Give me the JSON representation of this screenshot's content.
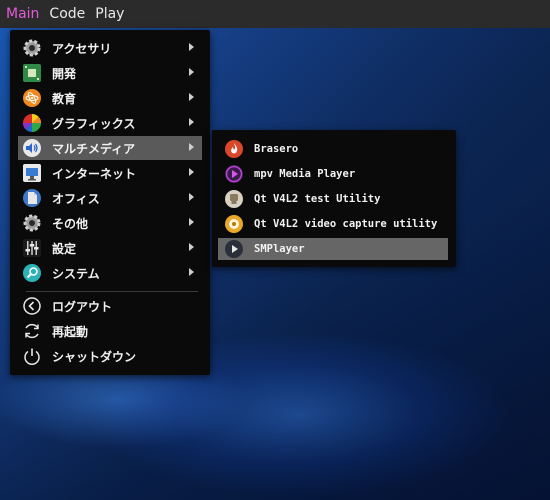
{
  "topbar": {
    "items": [
      "Main",
      "Code",
      "Play"
    ]
  },
  "main_menu": {
    "categories": [
      {
        "label": "アクセサリ",
        "icon": "accessories-gear-icon"
      },
      {
        "label": "開発",
        "icon": "development-board-icon"
      },
      {
        "label": "教育",
        "icon": "education-atom-icon"
      },
      {
        "label": "グラフィックス",
        "icon": "graphics-colorwheel-icon"
      },
      {
        "label": "マルチメディア",
        "icon": "multimedia-speaker-icon"
      },
      {
        "label": "インターネット",
        "icon": "internet-network-icon"
      },
      {
        "label": "オフィス",
        "icon": "office-document-icon"
      },
      {
        "label": "その他",
        "icon": "other-gear-icon"
      },
      {
        "label": "設定",
        "icon": "settings-sliders-icon"
      },
      {
        "label": "システム",
        "icon": "system-search-icon"
      }
    ],
    "actions": [
      {
        "label": "ログアウト",
        "icon": "logout-icon"
      },
      {
        "label": "再起動",
        "icon": "reboot-icon"
      },
      {
        "label": "シャットダウン",
        "icon": "shutdown-icon"
      }
    ],
    "selected_index": 4
  },
  "sub_menu": {
    "items": [
      {
        "label": "Brasero",
        "icon": "brasero-icon"
      },
      {
        "label": "mpv Media Player",
        "icon": "mpv-icon"
      },
      {
        "label": "Qt V4L2 test Utility",
        "icon": "qv4l2-icon"
      },
      {
        "label": "Qt V4L2 video capture utility",
        "icon": "qvidcap-icon"
      },
      {
        "label": "SMPlayer",
        "icon": "smplayer-icon"
      }
    ],
    "selected_index": 4
  },
  "colors": {
    "active_topbar": "#e45ad6",
    "menu_bg": "#0a0a0a",
    "highlight": "#5a5a5a"
  }
}
